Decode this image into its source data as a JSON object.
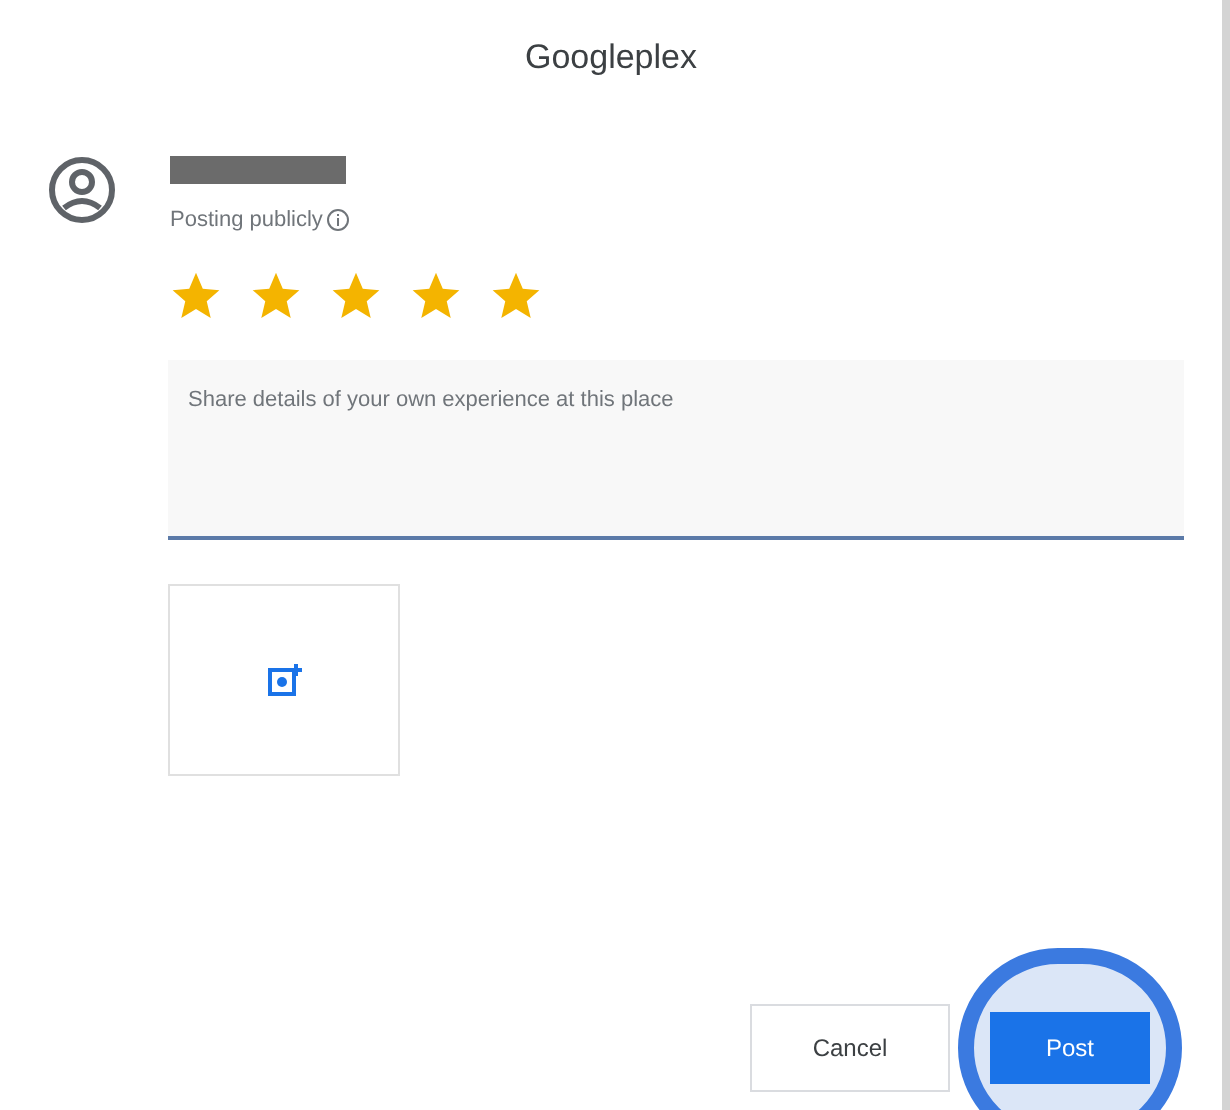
{
  "dialog": {
    "title": "Googleplex"
  },
  "author": {
    "visibility": "Posting publicly"
  },
  "rating": {
    "stars": 5
  },
  "review": {
    "placeholder": "Share details of your own experience at this place"
  },
  "buttons": [
    {
      "kind": "cancel",
      "label": "Cancel"
    },
    {
      "kind": "post",
      "label": "Post",
      "highlighted": true
    }
  ]
}
